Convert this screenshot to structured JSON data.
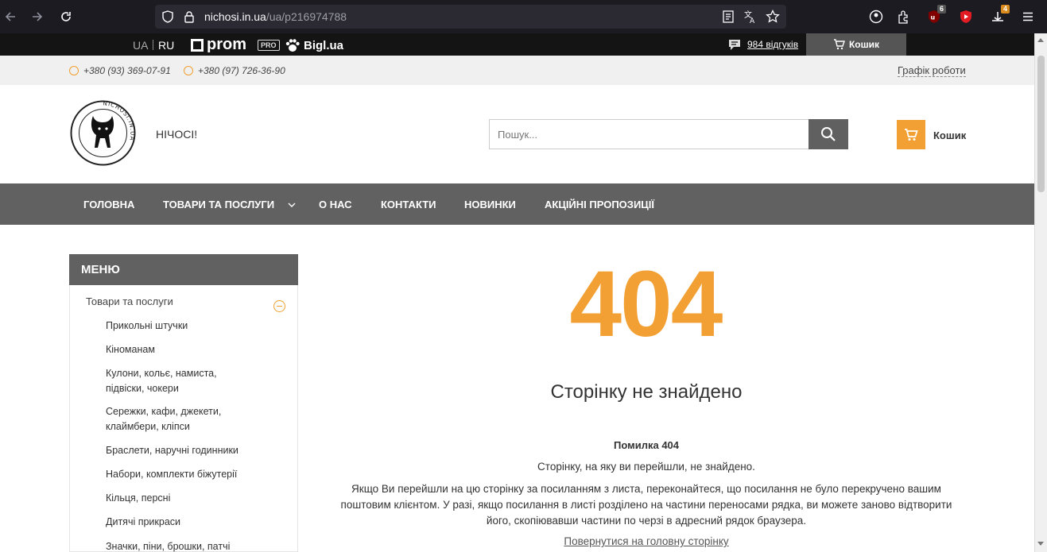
{
  "browser": {
    "url_host": "nichosi.in.ua",
    "url_path": "/ua/p216974788",
    "ext_badge_1": "6",
    "ext_badge_2": "4"
  },
  "topbar": {
    "lang_ua": "UA",
    "lang_ru": "RU",
    "prom_label": "prom",
    "pro_tag": "PRO",
    "bigl_label": "Bigl.ua",
    "reviews_label": "984 відгуків",
    "cart_label": "Кошик"
  },
  "contacts": {
    "phone1": "+380 (93) 369-07-91",
    "phone2": "+380 (97) 726-36-90",
    "schedule_label": "Графік роботи"
  },
  "header": {
    "site_name": "НІЧОСІ!",
    "logo_text": "NICHOSI.IN.UA",
    "search_placeholder": "Пошук...",
    "cart_label": "Кошик"
  },
  "nav": {
    "items": [
      "ГОЛОВНА",
      "ТОВАРИ ТА ПОСЛУГИ",
      "О НАС",
      "КОНТАКТИ",
      "НОВИНКИ",
      "АКЦІЙНІ ПРОПОЗИЦІЇ"
    ]
  },
  "sidebar": {
    "title": "МЕНЮ",
    "root": "Товари та послуги",
    "items": [
      "Прикольні штучки",
      "Кіноманам",
      "Кулони, кольє, намиста, підвіски, чокери",
      "Сережки, кафи, джекети, клаймбери, кліпси",
      "Браслети, наручні годинники",
      "Набори, комплекти біжутерії",
      "Кільця, персні",
      "Дитячі прикраси",
      "Значки, піни, брошки, патчі"
    ]
  },
  "error": {
    "code": "404",
    "heading": "Сторінку не знайдено",
    "title": "Помилка 404",
    "line1": "Сторінку, на яку ви перейшли, не знайдено.",
    "line2": "Якщо Ви перейшли на цю сторінку за посиланням з листа, переконайтеся, що посилання не було перекручено вашим поштовим клієнтом. У разі, якщо посилання в листі розділено на частини переносами рядка, ви можете заново відтворити його, скопіювавши частини по черзі в адресний рядок браузера.",
    "back_link": "Повернутися на головну сторінку"
  },
  "colors": {
    "accent": "#f2a034",
    "nav_bg": "#616161",
    "strip_bg": "#141414"
  }
}
